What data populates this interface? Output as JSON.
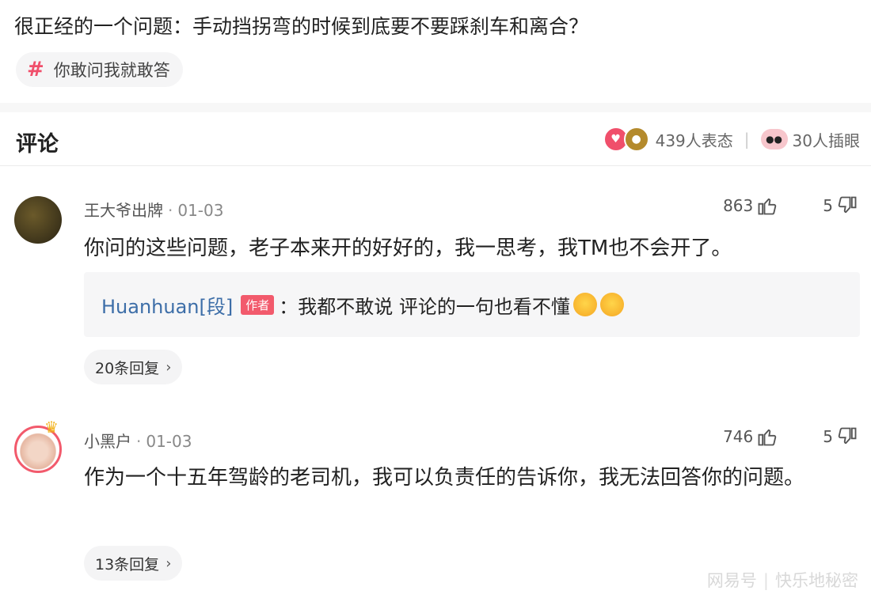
{
  "post": {
    "title": "很正经的一个问题：手动挡拐弯的时候到底要不要踩刹车和离合？",
    "topic": "你敢问我就敢答"
  },
  "comments_header": {
    "title": "评论",
    "reactions_text": "439人表态",
    "plug_text": "30人插眼"
  },
  "comments": [
    {
      "username": "王大爷出牌",
      "date": "01-03",
      "likes": "863",
      "dislikes": "5",
      "text": "你问的这些问题，老子本来开的好好的，我一思考，我TM也不会开了。",
      "author_reply": {
        "user": "Huanhuan[段]",
        "badge": "作者",
        "text": "：我都不敢说  评论的一句也看不懂"
      },
      "replies": "20条回复"
    },
    {
      "username": "小黑户",
      "date": "01-03",
      "likes": "746",
      "dislikes": "5",
      "text": "作为一个十五年驾龄的老司机，我可以负责任的告诉你，我无法回答你的问题。",
      "replies": "13条回复"
    }
  ],
  "watermark": {
    "source": "网易号",
    "account": "快乐地秘密"
  },
  "colors": {
    "accent": "#f04f6b",
    "link": "#3d6ea8"
  },
  "icons": [
    "hash-icon",
    "like-reaction-icon",
    "pot-reaction-icon",
    "eye-icon",
    "thumb-up-icon",
    "thumb-down-icon",
    "chevron-right-icon",
    "emoji-icon",
    "crown-icon"
  ]
}
